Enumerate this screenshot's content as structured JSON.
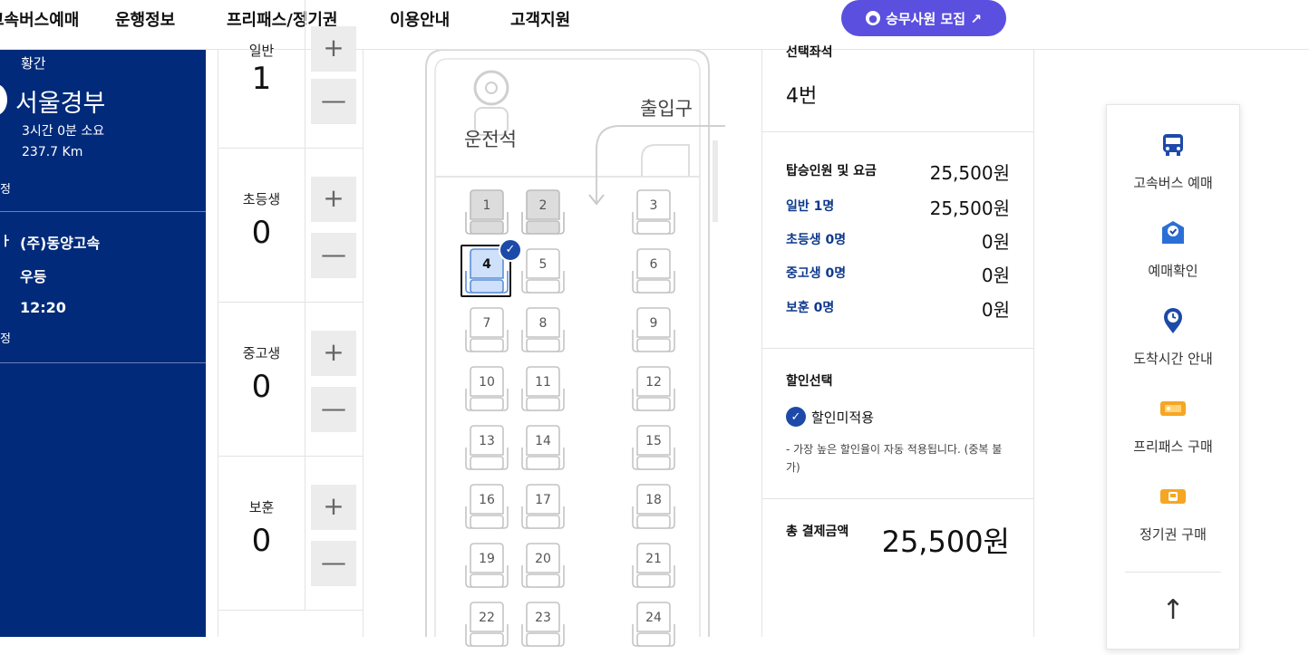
{
  "nav": {
    "items": [
      "고속버스예매",
      "운행정보",
      "프리패스/정기권",
      "이용안내",
      "고객지원"
    ],
    "recruit_label": "승무사원 모집 ↗"
  },
  "route": {
    "line_top": "황간",
    "destination": "서울경부",
    "duration": "3시간 0분 소요",
    "distance": "237.7 Km",
    "label_a": "정",
    "company": "(주)동양고속",
    "grade": "우등",
    "departure": "12:20",
    "label_b": "정"
  },
  "passengers": [
    {
      "label": "일반",
      "count": "1",
      "plus": "+",
      "minus": "—"
    },
    {
      "label": "초등생",
      "count": "0",
      "plus": "+",
      "minus": "—"
    },
    {
      "label": "중고생",
      "count": "0",
      "plus": "+",
      "minus": "—"
    },
    {
      "label": "보훈",
      "count": "0",
      "plus": "+",
      "minus": "—"
    }
  ],
  "seatmap": {
    "driver_label": "운전석",
    "entrance_label": "출입구",
    "seats": [
      "1",
      "2",
      "3",
      "4",
      "5",
      "6",
      "7",
      "8",
      "9",
      "10",
      "11",
      "12",
      "13",
      "14",
      "15",
      "16",
      "17",
      "18",
      "19",
      "20",
      "21",
      "22",
      "23",
      "24"
    ],
    "disabled_seats": [
      "1",
      "2"
    ],
    "selected_seat": "4"
  },
  "summary": {
    "selected_seat_title": "선택좌석",
    "selected_seat_value": "4번",
    "fare_title": "탑승인원 및 요금",
    "fare_total": "25,500원",
    "rows": [
      {
        "label": "일반 1명",
        "value": "25,500원"
      },
      {
        "label": "초등생 0명",
        "value": "0원"
      },
      {
        "label": "중고생 0명",
        "value": "0원"
      },
      {
        "label": "보훈 0명",
        "value": "0원"
      }
    ],
    "discount_title": "할인선택",
    "discount_option": "할인미적용",
    "discount_note": "- 가장 높은 할인율이 자동 적용됩니다. (중복 불가)",
    "total_label": "총 결제금액",
    "total_value": "25,500원"
  },
  "quickmenu": {
    "items": [
      "고속버스 예매",
      "예매확인",
      "도착시간 안내",
      "프리패스 구매",
      "정기권 구매"
    ],
    "top_label": "↑"
  },
  "colors": {
    "navy": "#012a7a",
    "recruit": "#5b4fe0",
    "accent_blue": "#1d4aa8",
    "icon_orange": "#f5a623"
  }
}
